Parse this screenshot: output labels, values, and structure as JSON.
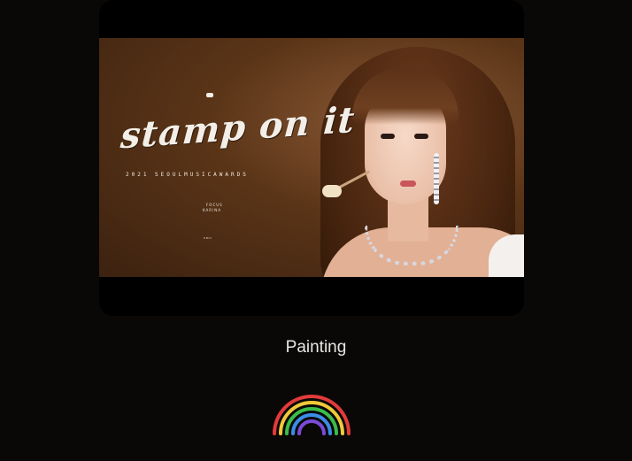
{
  "video": {
    "graffiti_title": "stamp on it",
    "event_line": "2021 SEOULMUSICAWARDS",
    "credit_title": "FOCUS",
    "credit_name": "KARINA",
    "credit_mini": "SMU"
  },
  "caption": {
    "label": "Painting"
  },
  "icons": {
    "rainbow": "rainbow-icon"
  },
  "colors": {
    "background": "#0a0807",
    "caption_text": "#e8e6e3"
  }
}
